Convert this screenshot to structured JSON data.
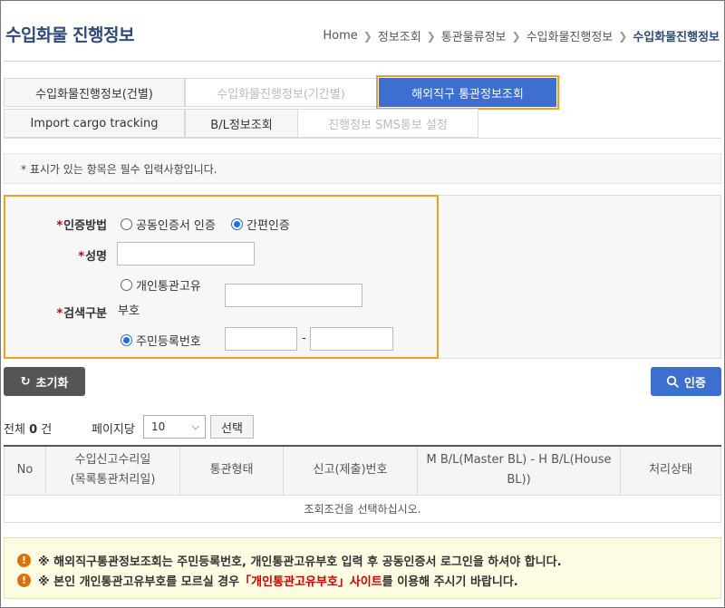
{
  "header": {
    "title": "수입화물 진행정보",
    "breadcrumb": [
      "Home",
      "정보조회",
      "통관물류정보",
      "수입화물진행정보",
      "수입화물진행정보"
    ]
  },
  "tabs_row1": [
    {
      "label": "수입화물진행정보(건별)",
      "state": "normal"
    },
    {
      "label": "수입화물진행정보(기간별)",
      "state": "disabled"
    },
    {
      "label": "해외직구 통관정보조회",
      "state": "active"
    }
  ],
  "tabs_row2": [
    {
      "label": "Import cargo tracking",
      "state": "normal"
    },
    {
      "label": "B/L정보조회",
      "state": "normal"
    },
    {
      "label": "진행정보 SMS통보 설정",
      "state": "disabled"
    }
  ],
  "notice": "* 표시가 있는 항목은 필수 입력사항입니다.",
  "form": {
    "auth_method_label": "인증방법",
    "auth_options": [
      {
        "label": "공동인증서 인증",
        "checked": false
      },
      {
        "label": "간편인증",
        "checked": true
      }
    ],
    "name_label": "성명",
    "name_value": "",
    "search_type_label": "검색구분",
    "opt_customs_line1": "개인통관고유",
    "opt_customs_line2": "부호",
    "opt_customs_checked": false,
    "opt_resident": "주민등록번호",
    "opt_resident_checked": true,
    "customs_value": "",
    "resident_front": "",
    "resident_back": "",
    "dash": "-"
  },
  "buttons": {
    "reset": "초기화",
    "auth": "인증",
    "select": "선택"
  },
  "paging": {
    "total_prefix": "전체",
    "total_count": "0",
    "total_suffix": "건",
    "per_page_label": "페이지당",
    "per_page_value": "10"
  },
  "table": {
    "headers": {
      "no": "No",
      "date_line1": "수입신고수리일",
      "date_line2": "(목록통관처리일)",
      "type": "통관형태",
      "decl": "신고(제출)번호",
      "bl_line1": "M B/L(Master BL) - H B/L(House",
      "bl_line2": "BL))",
      "status": "처리상태"
    },
    "empty_message": "조회조건을 선택하십시오."
  },
  "warnings": {
    "line1": "※ 해외직구통관정보조회는 주민등록번호, 개인통관고유부호 입력 후 공동인증서 로그인을 하셔야 합니다.",
    "line2_pre": "※ 본인 개인통관고유부호를 모르실 경우 ",
    "line2_link": "「개인통관고유부호」사이트",
    "line2_post": "를 이용해 주시기 바랍니다."
  },
  "colors": {
    "title": "#2d4a7a",
    "primary": "#3d6fd1",
    "highlight_border": "#f0a020",
    "required": "#cc0000",
    "warning_icon": "#e07000"
  }
}
